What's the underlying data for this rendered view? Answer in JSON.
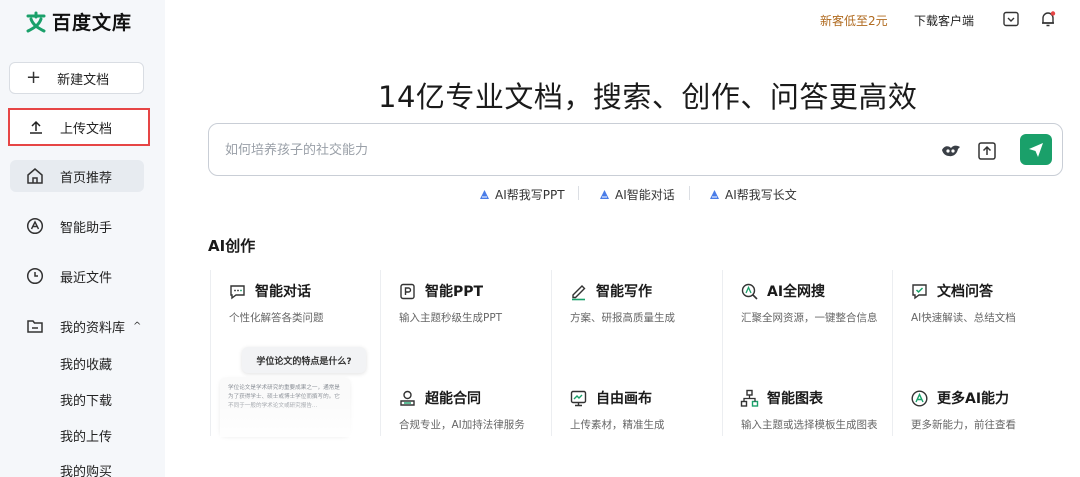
{
  "brand": {
    "name": "百度文库"
  },
  "sidebar": {
    "new_doc": "新建文档",
    "upload_doc": "上传文档",
    "items": [
      {
        "label": "首页推荐",
        "icon": "home-icon",
        "active": true
      },
      {
        "label": "智能助手",
        "icon": "ai-assistant-icon",
        "active": false
      },
      {
        "label": "最近文件",
        "icon": "clock-icon",
        "active": false
      },
      {
        "label": "我的资料库",
        "icon": "folder-icon",
        "active": false
      }
    ],
    "library_sub": [
      "我的收藏",
      "我的下载",
      "我的上传",
      "我的购买"
    ]
  },
  "topbar": {
    "promo": "新客低至2元",
    "download_client": "下载客户端"
  },
  "main": {
    "headline": "14亿专业文档，搜索、创作、问答更高效",
    "search_placeholder": "如何培养孩子的社交能力",
    "quick_actions": [
      "AI帮我写PPT",
      "AI智能对话",
      "AI帮我写长文"
    ],
    "section_title": "AI创作",
    "cards": [
      {
        "title": "智能对话",
        "desc": "个性化解答各类问题",
        "icon": "chat-icon"
      },
      {
        "title": "智能PPT",
        "desc": "输入主题秒级生成PPT",
        "icon": "ppt-icon"
      },
      {
        "title": "智能写作",
        "desc": "方案、研报高质量生成",
        "icon": "pen-icon"
      },
      {
        "title": "AI全网搜",
        "desc": "汇聚全网资源，一键整合信息",
        "icon": "web-search-icon"
      },
      {
        "title": "文档问答",
        "desc": "AI快速解读、总结文档",
        "icon": "doc-qa-icon"
      },
      {
        "title": "超能合同",
        "desc": "合规专业，AI加持法律服务",
        "icon": "contract-icon"
      },
      {
        "title": "自由画布",
        "desc": "上传素材，精准生成",
        "icon": "canvas-icon"
      },
      {
        "title": "智能图表",
        "desc": "输入主题或选择模板生成图表",
        "icon": "flowchart-icon"
      },
      {
        "title": "更多AI能力",
        "desc": "更多新能力，前往查看",
        "icon": "more-ai-icon"
      }
    ],
    "preview": {
      "question": "学位论文的特点是什么?",
      "answer": "学位论文是学术研究的重要成果之一，通常是为了获得学士、硕士或博士学位而撰写的。它不同于一般的学术论文或研究报告..."
    }
  },
  "colors": {
    "accent": "#1aa06a",
    "promo": "#b06a1f",
    "highlight_border": "#e64545"
  }
}
